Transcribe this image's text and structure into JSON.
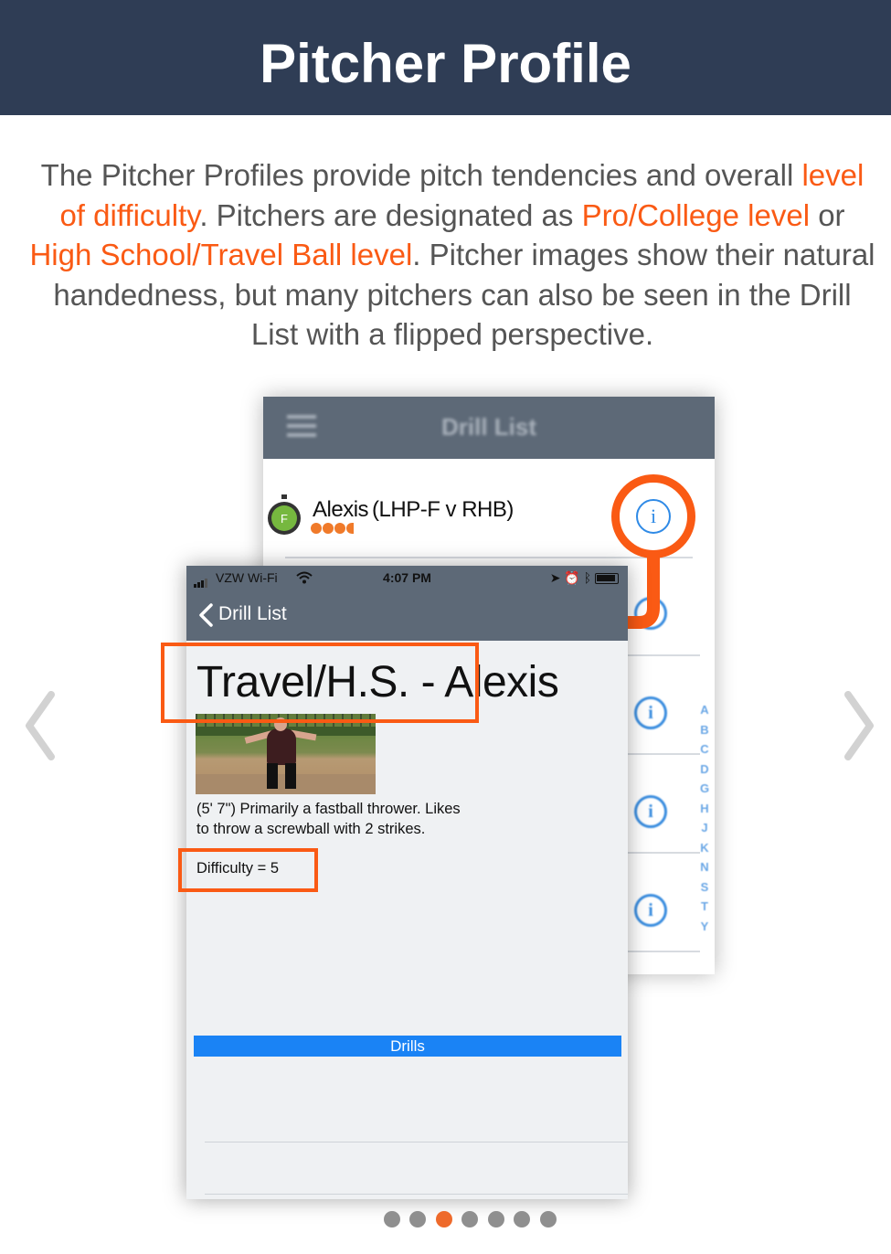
{
  "header": {
    "title": "Pitcher Profile"
  },
  "description": {
    "p1": "The Pitcher Profiles provide pitch tendencies and overall",
    "h1": "level of difficulty",
    "p2": ". Pitchers are designated as ",
    "h2": "Pro/College level",
    "p3": " or ",
    "h3": "High School/Travel Ball level",
    "p4": ". Pitcher images show their natural handedness, but many pitchers can also be seen in the Drill List with a flipped perspective."
  },
  "back_screen": {
    "nav_title": "Drill List",
    "row": {
      "name": "Alexis",
      "detail": "(LHP-F v RHB)",
      "badge": "F",
      "difficulty_dots": 4
    },
    "alpha_index": [
      "A",
      "B",
      "C",
      "D",
      "G",
      "H",
      "J",
      "K",
      "N",
      "S",
      "T",
      "Y"
    ]
  },
  "front_screen": {
    "status": {
      "carrier": "VZW Wi-Fi",
      "time": "4:07 PM"
    },
    "back_label": "Drill List",
    "title": "Travel/H.S. - Alexis",
    "description": "(5' 7\") Primarily a fastball thrower. Likes to throw a screwball with 2 strikes.",
    "difficulty": "Difficulty = 5",
    "drills_button": "Drills"
  },
  "pager": {
    "total": 7,
    "active": 3
  },
  "colors": {
    "header": "#2f3d55",
    "accent": "#fa5a14",
    "nav": "#5d6977",
    "drills": "#1a83f5",
    "info": "#2f8ae6"
  },
  "icons": [
    "hamburger-icon",
    "stopwatch-icon",
    "info-icon",
    "chevron-left-icon",
    "chevron-right-icon",
    "wifi-icon",
    "battery-icon"
  ]
}
